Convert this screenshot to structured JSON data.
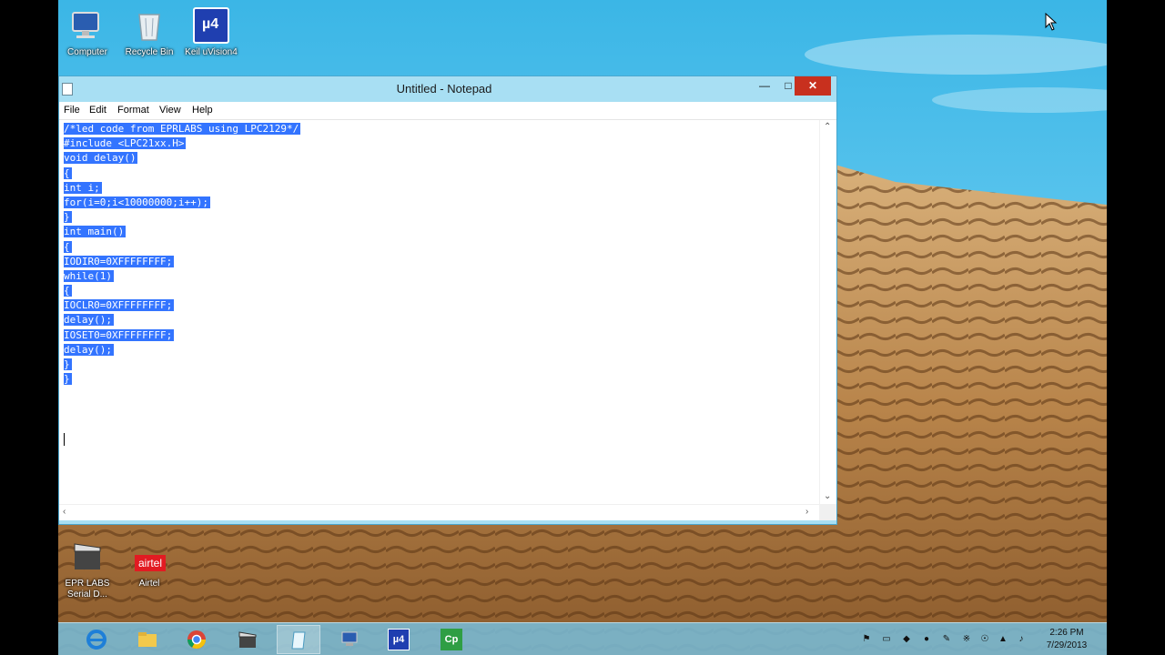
{
  "desktop_icons": [
    {
      "label": "Computer"
    },
    {
      "label": "Recycle Bin"
    },
    {
      "label": "Keil uVision4"
    },
    {
      "label": "EPR LABS Serial D..."
    },
    {
      "label": "Airtel"
    }
  ],
  "airtel_logo_text": "airtel",
  "keil_badge": "µ4",
  "notepad": {
    "title": "Untitled - Notepad",
    "menu": [
      "File",
      "Edit",
      "Format",
      "View",
      "Help"
    ],
    "code_lines": [
      "/*led code from EPRLABS using LPC2129*/",
      "#include <LPC21xx.H>",
      "void delay()",
      "{",
      "int i;",
      "for(i=0;i<10000000;i++);",
      "}",
      "int main()",
      "{",
      "IODIR0=0XFFFFFFFF;",
      "while(1)",
      "{",
      "IOCLR0=0XFFFFFFFF;",
      "delay();",
      "IOSET0=0XFFFFFFFF;",
      "delay();",
      "}",
      "}"
    ]
  },
  "taskbar": {
    "apps": [
      "internet-explorer",
      "file-explorer",
      "chrome",
      "epr-labs-serial",
      "notepad",
      "network",
      "keil-uvision4",
      "camtasia"
    ],
    "active_app": "notepad",
    "cp_label": "Cp",
    "clock_time": "2:26 PM",
    "clock_date": "7/29/2013"
  },
  "colors": {
    "selection": "#3374ff",
    "close_button": "#c8301e",
    "window_frame": "#a8dff3"
  }
}
